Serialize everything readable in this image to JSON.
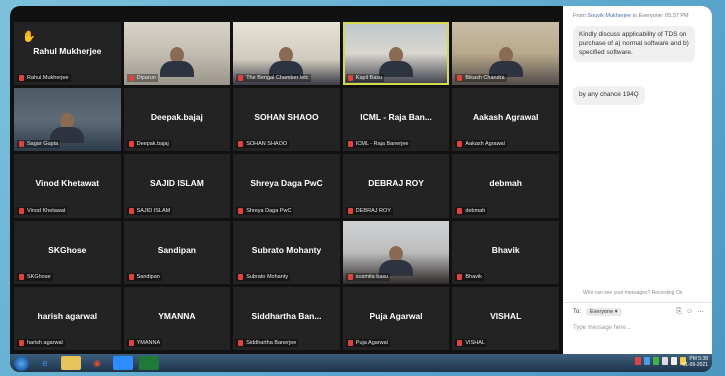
{
  "tiles": [
    {
      "name": "Rahul Mukherjee",
      "tag": "Rahul Mukherjee",
      "type": "name",
      "hand": true
    },
    {
      "name": "",
      "tag": "Diparun",
      "type": "video",
      "bg": "vid1"
    },
    {
      "name": "",
      "tag": "The Bengal Chamber letc",
      "type": "video",
      "bg": "vid2"
    },
    {
      "name": "",
      "tag": "Kapil Basu",
      "type": "video",
      "bg": "vid3",
      "active": true
    },
    {
      "name": "",
      "tag": "Bikash Chandra",
      "type": "video",
      "bg": "vid4"
    },
    {
      "name": "",
      "tag": "Sagar Gupta",
      "type": "video",
      "bg": "vid5"
    },
    {
      "name": "Deepak.bajaj",
      "tag": "Deepak.bajaj",
      "type": "name"
    },
    {
      "name": "SOHAN SHAOO",
      "tag": "SOHAN SHAOO",
      "type": "name"
    },
    {
      "name": "ICML - Raja Ban...",
      "tag": "ICML - Raja Banerjee",
      "type": "name"
    },
    {
      "name": "Aakash Agrawal",
      "tag": "Aakash Agrawal",
      "type": "name"
    },
    {
      "name": "Vinod Khetawat",
      "tag": "Vinod Khetawat",
      "type": "name"
    },
    {
      "name": "SAJID ISLAM",
      "tag": "SAJID ISLAM",
      "type": "name"
    },
    {
      "name": "Shreya Daga PwC",
      "tag": "Shreya Daga PwC",
      "type": "name"
    },
    {
      "name": "DEBRAJ ROY",
      "tag": "DEBRAJ ROY",
      "type": "name"
    },
    {
      "name": "debmah",
      "tag": "debmah",
      "type": "name"
    },
    {
      "name": "SKGhose",
      "tag": "SKGhose",
      "type": "name"
    },
    {
      "name": "Sandipan",
      "tag": "Sandipan",
      "type": "name"
    },
    {
      "name": "Subrato Mohanty",
      "tag": "Subrato Mohanty",
      "type": "name"
    },
    {
      "name": "",
      "tag": "susmita basu",
      "type": "video",
      "bg": "vid6"
    },
    {
      "name": "Bhavik",
      "tag": "Bhavik",
      "type": "name"
    },
    {
      "name": "harish agarwal",
      "tag": "harish agarwal",
      "type": "name"
    },
    {
      "name": "YMANNA",
      "tag": "YMANNA",
      "type": "name"
    },
    {
      "name": "Siddhartha  Ban...",
      "tag": "Siddhartha Banerjee",
      "type": "name"
    },
    {
      "name": "Puja Agarwal",
      "tag": "Puja Agarwal",
      "type": "name"
    },
    {
      "name": "VISHAL",
      "tag": "VISHAL",
      "type": "name"
    }
  ],
  "chat": {
    "header_from": "From",
    "header_sender": "Souvik Mukherjee",
    "header_to": "to Everyone:",
    "header_time": "05:37 PM",
    "message1": "Kindly discuss applicability of TDS on purchase of a) normal software and b) specified software.",
    "message2": "by any chance 194Q",
    "visibility_note": "Who can see your messages? Recording On",
    "to_label": "To:",
    "to_value": "Everyone",
    "input_placeholder": "Type message here..."
  },
  "taskbar": {
    "time": "PM 5:38",
    "date": "01-09-2021"
  },
  "colors": {
    "active_border": "#d6d94a",
    "mic_off": "#e0433a",
    "hand": "#f2b31c"
  }
}
